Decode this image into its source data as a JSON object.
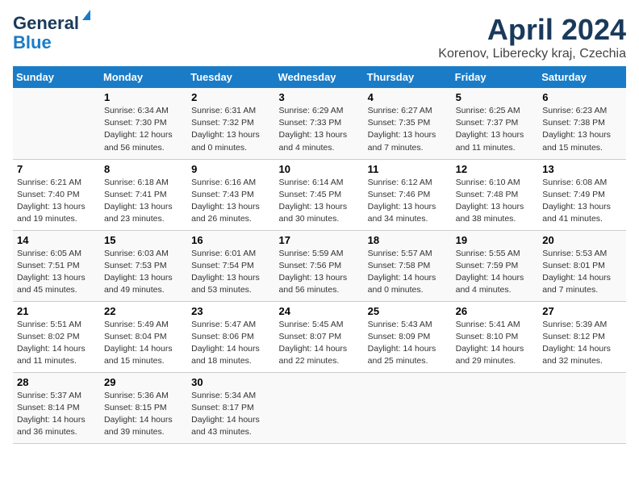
{
  "logo": {
    "line1": "General",
    "line2": "Blue"
  },
  "title": "April 2024",
  "subtitle": "Korenov, Liberecky kraj, Czechia",
  "weekdays": [
    "Sunday",
    "Monday",
    "Tuesday",
    "Wednesday",
    "Thursday",
    "Friday",
    "Saturday"
  ],
  "weeks": [
    [
      {
        "day": "",
        "text": ""
      },
      {
        "day": "1",
        "text": "Sunrise: 6:34 AM\nSunset: 7:30 PM\nDaylight: 12 hours\nand 56 minutes."
      },
      {
        "day": "2",
        "text": "Sunrise: 6:31 AM\nSunset: 7:32 PM\nDaylight: 13 hours\nand 0 minutes."
      },
      {
        "day": "3",
        "text": "Sunrise: 6:29 AM\nSunset: 7:33 PM\nDaylight: 13 hours\nand 4 minutes."
      },
      {
        "day": "4",
        "text": "Sunrise: 6:27 AM\nSunset: 7:35 PM\nDaylight: 13 hours\nand 7 minutes."
      },
      {
        "day": "5",
        "text": "Sunrise: 6:25 AM\nSunset: 7:37 PM\nDaylight: 13 hours\nand 11 minutes."
      },
      {
        "day": "6",
        "text": "Sunrise: 6:23 AM\nSunset: 7:38 PM\nDaylight: 13 hours\nand 15 minutes."
      }
    ],
    [
      {
        "day": "7",
        "text": "Sunrise: 6:21 AM\nSunset: 7:40 PM\nDaylight: 13 hours\nand 19 minutes."
      },
      {
        "day": "8",
        "text": "Sunrise: 6:18 AM\nSunset: 7:41 PM\nDaylight: 13 hours\nand 23 minutes."
      },
      {
        "day": "9",
        "text": "Sunrise: 6:16 AM\nSunset: 7:43 PM\nDaylight: 13 hours\nand 26 minutes."
      },
      {
        "day": "10",
        "text": "Sunrise: 6:14 AM\nSunset: 7:45 PM\nDaylight: 13 hours\nand 30 minutes."
      },
      {
        "day": "11",
        "text": "Sunrise: 6:12 AM\nSunset: 7:46 PM\nDaylight: 13 hours\nand 34 minutes."
      },
      {
        "day": "12",
        "text": "Sunrise: 6:10 AM\nSunset: 7:48 PM\nDaylight: 13 hours\nand 38 minutes."
      },
      {
        "day": "13",
        "text": "Sunrise: 6:08 AM\nSunset: 7:49 PM\nDaylight: 13 hours\nand 41 minutes."
      }
    ],
    [
      {
        "day": "14",
        "text": "Sunrise: 6:05 AM\nSunset: 7:51 PM\nDaylight: 13 hours\nand 45 minutes."
      },
      {
        "day": "15",
        "text": "Sunrise: 6:03 AM\nSunset: 7:53 PM\nDaylight: 13 hours\nand 49 minutes."
      },
      {
        "day": "16",
        "text": "Sunrise: 6:01 AM\nSunset: 7:54 PM\nDaylight: 13 hours\nand 53 minutes."
      },
      {
        "day": "17",
        "text": "Sunrise: 5:59 AM\nSunset: 7:56 PM\nDaylight: 13 hours\nand 56 minutes."
      },
      {
        "day": "18",
        "text": "Sunrise: 5:57 AM\nSunset: 7:58 PM\nDaylight: 14 hours\nand 0 minutes."
      },
      {
        "day": "19",
        "text": "Sunrise: 5:55 AM\nSunset: 7:59 PM\nDaylight: 14 hours\nand 4 minutes."
      },
      {
        "day": "20",
        "text": "Sunrise: 5:53 AM\nSunset: 8:01 PM\nDaylight: 14 hours\nand 7 minutes."
      }
    ],
    [
      {
        "day": "21",
        "text": "Sunrise: 5:51 AM\nSunset: 8:02 PM\nDaylight: 14 hours\nand 11 minutes."
      },
      {
        "day": "22",
        "text": "Sunrise: 5:49 AM\nSunset: 8:04 PM\nDaylight: 14 hours\nand 15 minutes."
      },
      {
        "day": "23",
        "text": "Sunrise: 5:47 AM\nSunset: 8:06 PM\nDaylight: 14 hours\nand 18 minutes."
      },
      {
        "day": "24",
        "text": "Sunrise: 5:45 AM\nSunset: 8:07 PM\nDaylight: 14 hours\nand 22 minutes."
      },
      {
        "day": "25",
        "text": "Sunrise: 5:43 AM\nSunset: 8:09 PM\nDaylight: 14 hours\nand 25 minutes."
      },
      {
        "day": "26",
        "text": "Sunrise: 5:41 AM\nSunset: 8:10 PM\nDaylight: 14 hours\nand 29 minutes."
      },
      {
        "day": "27",
        "text": "Sunrise: 5:39 AM\nSunset: 8:12 PM\nDaylight: 14 hours\nand 32 minutes."
      }
    ],
    [
      {
        "day": "28",
        "text": "Sunrise: 5:37 AM\nSunset: 8:14 PM\nDaylight: 14 hours\nand 36 minutes."
      },
      {
        "day": "29",
        "text": "Sunrise: 5:36 AM\nSunset: 8:15 PM\nDaylight: 14 hours\nand 39 minutes."
      },
      {
        "day": "30",
        "text": "Sunrise: 5:34 AM\nSunset: 8:17 PM\nDaylight: 14 hours\nand 43 minutes."
      },
      {
        "day": "",
        "text": ""
      },
      {
        "day": "",
        "text": ""
      },
      {
        "day": "",
        "text": ""
      },
      {
        "day": "",
        "text": ""
      }
    ]
  ]
}
